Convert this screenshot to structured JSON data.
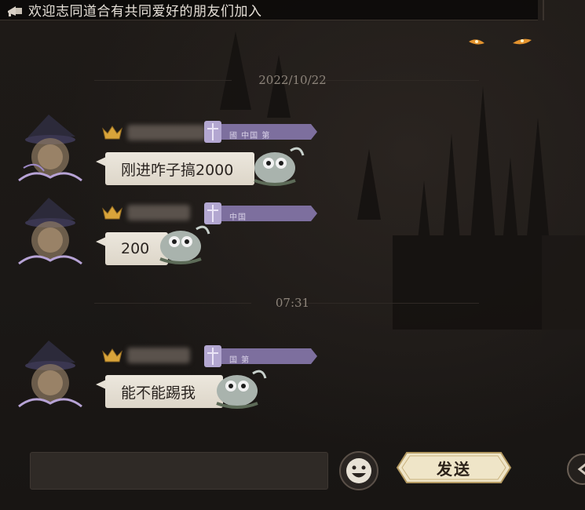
{
  "announcement": {
    "text": "欢迎志同道合有共同爱好的朋友们加入"
  },
  "timestamps": [
    "2022/10/22",
    "07:31"
  ],
  "messages": [
    {
      "text": "刚进咋子搞2000",
      "badge": "國 中国 第"
    },
    {
      "text": "200",
      "badge": "中国"
    },
    {
      "text": "能不能踢我",
      "badge": "国 第"
    }
  ],
  "input": {
    "placeholder": ""
  },
  "send_label": "发送",
  "colors": {
    "background": "#1a1715",
    "bubble": "#e6e0d5",
    "send_button": "#efe5c8",
    "badge": "#7d6f9e",
    "vip_gold": "#d9a43a"
  },
  "icons": [
    "horn-icon",
    "vip-crown-icon",
    "title-badge-icon",
    "owl-sticker-icon",
    "emoji-icon",
    "send-button",
    "arrow-icon"
  ]
}
